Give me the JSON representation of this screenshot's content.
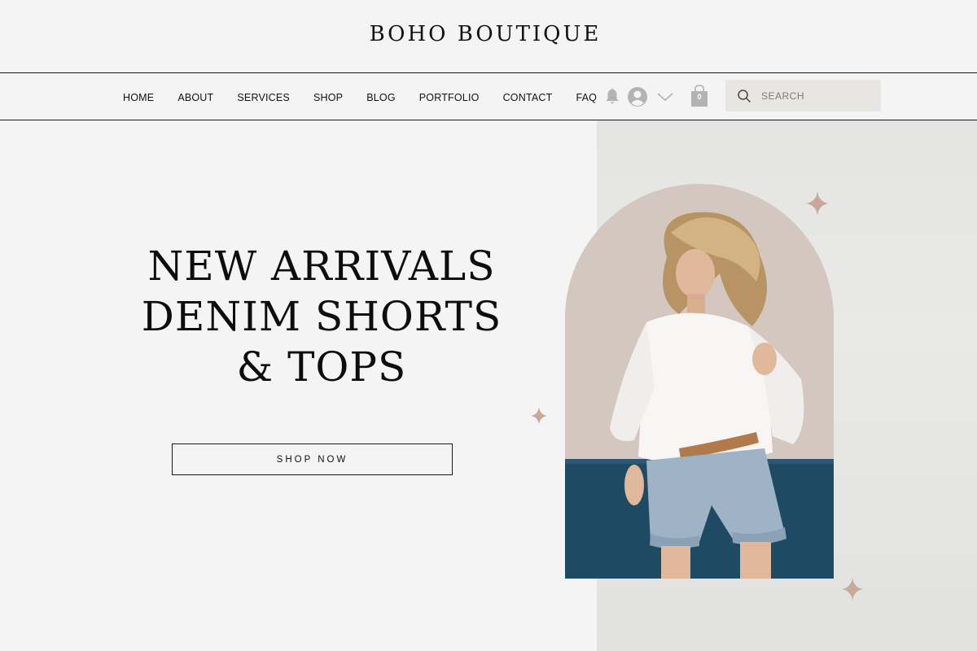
{
  "brand": "BOHO BOUTIQUE",
  "nav": {
    "items": [
      "HOME",
      "ABOUT",
      "SERVICES",
      "SHOP",
      "BLOG",
      "PORTFOLIO",
      "CONTACT",
      "FAQ"
    ]
  },
  "header_tools": {
    "icons": [
      "bell-icon",
      "avatar-icon",
      "chevron-down-icon",
      "shopping-bag-icon"
    ],
    "cart_count": "0"
  },
  "search": {
    "placeholder": "SEARCH",
    "value": ""
  },
  "hero": {
    "headline_lines": [
      "NEW ARRIVALS",
      "DENIM SHORTS",
      "& TOPS"
    ],
    "cta_label": "SHOP NOW"
  },
  "colors": {
    "background": "#f4f4f4",
    "text": "#111111",
    "accent_sparkle": "#c9a89a",
    "arch_bg": "#cdbfb6",
    "denim_wall": "#1f4a63"
  }
}
